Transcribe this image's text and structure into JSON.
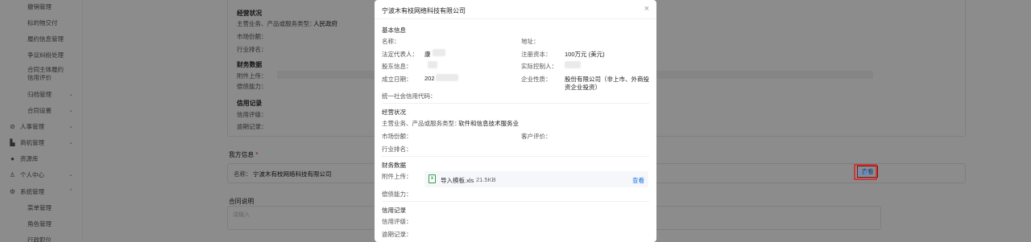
{
  "sidebar": {
    "items": [
      {
        "label": "撤销管理",
        "icon": ""
      },
      {
        "label": "标的物交付",
        "icon": ""
      },
      {
        "label": "履约信息管理",
        "icon": ""
      },
      {
        "label": "争议纠纷处理",
        "icon": ""
      },
      {
        "label": "合同主体履约信用评价",
        "icon": ""
      },
      {
        "label": "归档管理",
        "icon": ""
      },
      {
        "label": "合同设置",
        "icon": ""
      },
      {
        "label": "人事管理",
        "icon": "check-circle-icon"
      },
      {
        "label": "商机管理",
        "icon": "bar-chart-icon"
      },
      {
        "label": "资源库",
        "icon": "location-pin-icon"
      },
      {
        "label": "个人中心",
        "icon": "user-icon"
      },
      {
        "label": "系统管理",
        "icon": "gear-icon"
      },
      {
        "label": "菜单管理",
        "icon": ""
      },
      {
        "label": "角色管理",
        "icon": ""
      },
      {
        "label": "行政职位",
        "icon": ""
      }
    ]
  },
  "main": {
    "ops_title": "经营状况",
    "biz_type_label": "主营业务、产品或服务类型：",
    "biz_type_value": "人民政府",
    "market_share_label": "市场份额：",
    "industry_rank_label": "行业排名：",
    "finance_title": "财务数据",
    "attach_label": "附件上传：",
    "debt_label": "偿债能力：",
    "credit_title": "信用记录",
    "credit_rating_label": "信用评级：",
    "overdue_label": "逾期记录：",
    "my_info_title": "我方信息",
    "required_mark": "*",
    "my_name_label": "名称：",
    "my_name_value": "宁波木有枝网络科技有限公司",
    "view_button": "查看",
    "contract_note_title": "合同说明",
    "note_placeholder": "请输入"
  },
  "modal": {
    "title": "宁波木有枝网络科技有限公司",
    "basic_title": "基本信息",
    "name_label": "名称：",
    "address_label": "地址：",
    "legal_rep_label": "法定代表人：",
    "legal_rep_value": "康",
    "reg_capital_label": "注册资本：",
    "reg_capital_value": "100万元 (美元)",
    "shareholder_label": "股东信息：",
    "controller_label": "实际控制人：",
    "established_label": "成立日期：",
    "established_value": "202",
    "company_type_label": "企业性质：",
    "company_type_value_1": "股份有限公司（非上市、外商投",
    "company_type_value_2": "资企业投资）",
    "credit_code_label": "统一社会信用代码：",
    "ops_title": "经营状况",
    "biz_type_label": "主营业务、产品或服务类型：",
    "biz_type_value": "软件和信息技术服务业",
    "market_share_label": "市场份额：",
    "customer_review_label": "客户评价：",
    "industry_rank_label": "行业排名：",
    "finance_title": "财务数据",
    "attach_label": "附件上传：",
    "file_name": "导入模板.xls",
    "file_size": "21.5KB",
    "file_view": "查看",
    "debt_label": "偿债能力：",
    "credit_title": "信用记录",
    "credit_rating_label": "信用评级：",
    "overdue_label": "逾期记录：",
    "close_glyph": "×"
  },
  "colors": {
    "overlay": "#000000",
    "link": "#1a73e8",
    "annotation": "#e02020",
    "excel_green": "#2e9d4e"
  }
}
